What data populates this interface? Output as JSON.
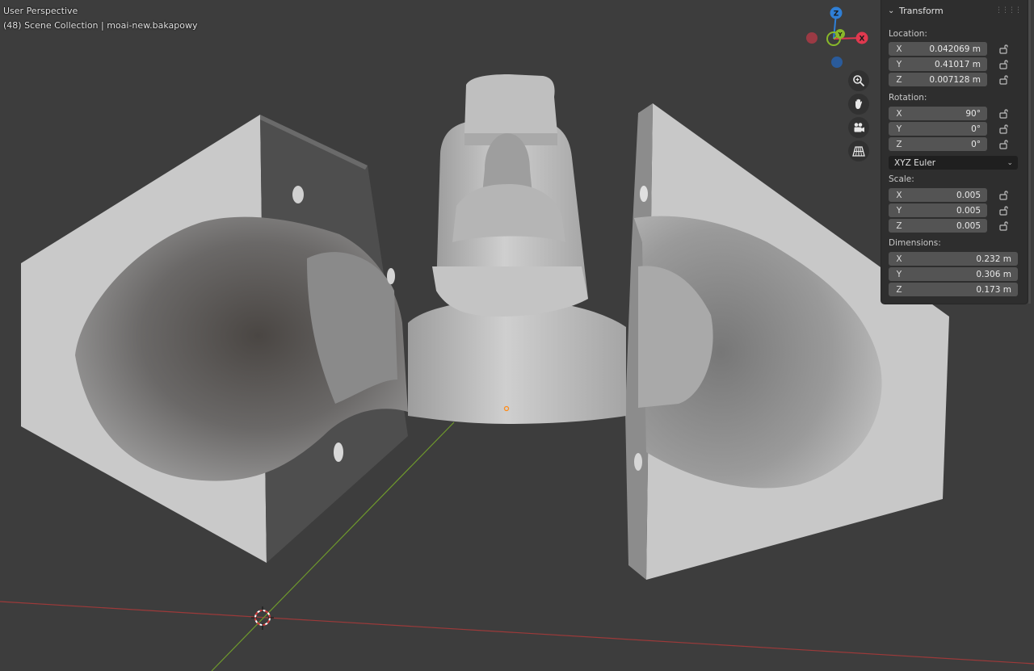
{
  "viewport": {
    "title": "User Perspective",
    "collection": "(48) Scene Collection | moai-new.bakapowy"
  },
  "gizmo": {
    "x_label": "X",
    "y_label": "Y",
    "z_label": "Z",
    "x_color": "#e0394f",
    "y_color": "#88b82a",
    "z_color": "#2f7fd6"
  },
  "nav_icons": [
    "zoom-icon",
    "hand-pan-icon",
    "camera-icon",
    "grid-perspective-icon"
  ],
  "transform": {
    "header": "Transform",
    "location": {
      "label": "Location:",
      "x": {
        "axis": "X",
        "value": "0.042069 m"
      },
      "y": {
        "axis": "Y",
        "value": "0.41017 m"
      },
      "z": {
        "axis": "Z",
        "value": "0.007128 m"
      }
    },
    "rotation": {
      "label": "Rotation:",
      "x": {
        "axis": "X",
        "value": "90°"
      },
      "y": {
        "axis": "Y",
        "value": "0°"
      },
      "z": {
        "axis": "Z",
        "value": "0°"
      },
      "mode": "XYZ Euler"
    },
    "scale": {
      "label": "Scale:",
      "x": {
        "axis": "X",
        "value": "0.005"
      },
      "y": {
        "axis": "Y",
        "value": "0.005"
      },
      "z": {
        "axis": "Z",
        "value": "0.005"
      }
    },
    "dimensions": {
      "label": "Dimensions:",
      "x": {
        "axis": "X",
        "value": "0.232 m"
      },
      "y": {
        "axis": "Y",
        "value": "0.306 m"
      },
      "z": {
        "axis": "Z",
        "value": "0.173 m"
      }
    }
  },
  "colors": {
    "viewport_bg": "#3d3d3d",
    "panel_bg": "#2e2e2e",
    "field_bg": "#545454",
    "x_axis_line": "#9c3a3a",
    "y_axis_line": "#6f9a2c",
    "origin_dot": "#ff8c1a"
  }
}
